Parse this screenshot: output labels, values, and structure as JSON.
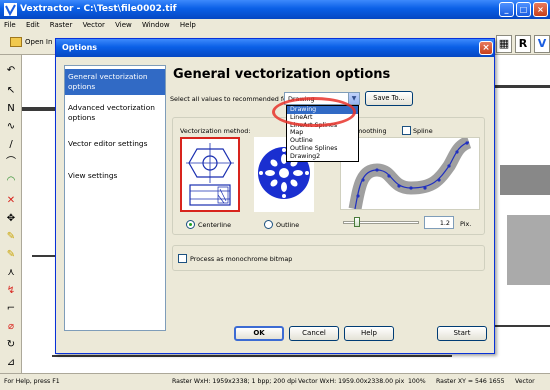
{
  "app": {
    "title": "Vextractor - C:\\Test\\file0002.tif",
    "menu": [
      "File",
      "Edit",
      "Raster",
      "Vector",
      "View",
      "Window",
      "Help"
    ],
    "open_label": "Open In"
  },
  "right_toolbar": [
    "R",
    "V"
  ],
  "dialog": {
    "title": "Options",
    "nav": [
      "General vectorization options",
      "Advanced vectorization options",
      "Vector editor settings",
      "View settings"
    ],
    "page_title": "General vectorization options",
    "recommend_label": "Select all values to recommended for:",
    "recommend_value": "Drawing",
    "saveto_label": "Save To...",
    "dropdown_options": [
      "Drawing",
      "LineArt",
      "LineArt Splines",
      "Map",
      "Outline",
      "Outline Splines",
      "Drawing2"
    ],
    "selected_option_index": 0,
    "method_label": "Vectorization method:",
    "smoothing_label": "Smoothing",
    "spline_label": "Spline",
    "spline_checked": false,
    "centerline_label": "Centerline",
    "outline_label": "Outline",
    "selected_method": "Centerline",
    "smoothing_value": "1.2",
    "smoothing_slider_fraction": 0.12,
    "px_label": "Pix.",
    "monochrome_label": "Process as monochrome bitmap",
    "monochrome_checked": false,
    "buttons": {
      "ok": "OK",
      "cancel": "Cancel",
      "help": "Help",
      "start": "Start"
    }
  },
  "status": {
    "help": "For Help, press F1",
    "raster_info": "Raster WxH: 1959x2338; 1 bpp; 200 dpi",
    "vector_info": "Vector WxH: 1959.00x2338.00 pix",
    "zoom": "100%",
    "raster_xy": "Raster XY = 546 1655",
    "vector_label": "Vector"
  },
  "colors": {
    "titlebar": "#0a5fe6",
    "selection": "#316ac5",
    "highlight_ellipse": "#e8332a"
  }
}
